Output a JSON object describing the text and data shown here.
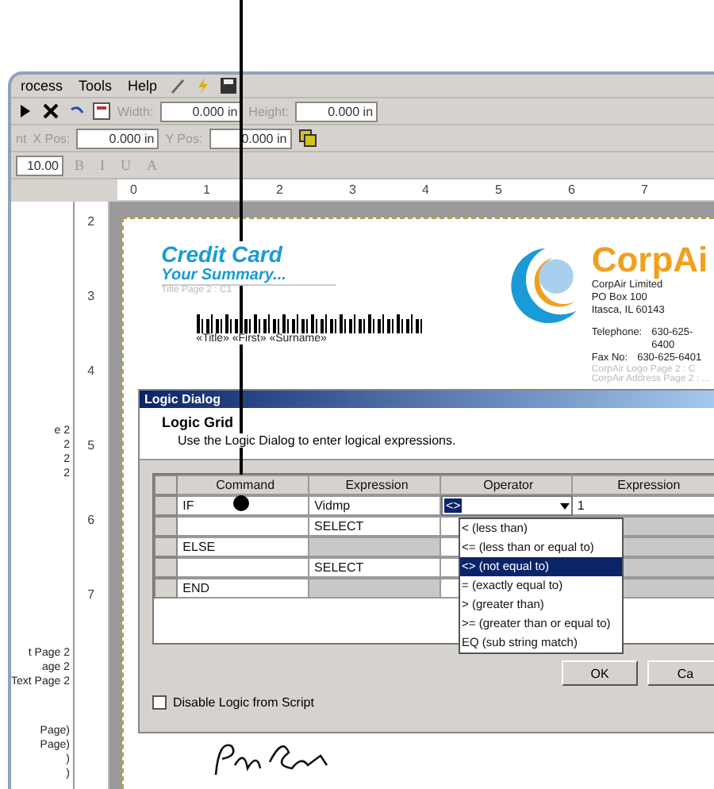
{
  "menu": [
    {
      "label": "rocess"
    },
    {
      "label": "Tools"
    },
    {
      "label": "Help"
    }
  ],
  "size_fields": [
    {
      "label": "Width:",
      "value": "0.000 in"
    },
    {
      "label": "Height:",
      "value": "0.000 in"
    }
  ],
  "position_fields": [
    {
      "label": "X Pos:",
      "value": "0.000 in"
    },
    {
      "label": "Y Pos:",
      "value": "0.000 in"
    }
  ],
  "cut_label": "nt",
  "font_size": "10.00",
  "format_buttons": [
    "B",
    "I",
    "U",
    "A"
  ],
  "ruler": [
    "0",
    "1",
    "2",
    "3",
    "4",
    "5",
    "6",
    "7"
  ],
  "vertical_ruler": [
    "2",
    "3",
    "4",
    "5",
    "6",
    "7"
  ],
  "tree_groups": [
    [
      "e 2",
      "2",
      "2",
      "2"
    ],
    [
      "t Page 2",
      "age 2",
      "Text Page 2"
    ],
    [
      "Page)",
      "Page)",
      ")",
      ")"
    ]
  ],
  "document": {
    "title": "Credit Card",
    "subtitle": "Your Summary...",
    "caption": "Title Page 2 : C1",
    "merge_fields": "«Title» «First» «Surname»",
    "company": "CorpAi",
    "address": [
      "CorpAir Limited",
      "PO Box 100",
      "Itasca, IL 60143"
    ],
    "contacts": [
      {
        "label": "Telephone:",
        "value": "630-625-6400"
      },
      {
        "label": "Fax No:",
        "value": "630-625-6401"
      }
    ],
    "logo_caption": "CorpAir Logo Page 2 : C",
    "address_caption": "CorpAir Address Page 2 : ..."
  },
  "dialog": {
    "title": "Logic Dialog",
    "heading": "Logic Grid",
    "description": "Use the Logic Dialog to enter logical expressions.",
    "columns": [
      "Command",
      "Expression",
      "Operator",
      "Expression"
    ],
    "rows": [
      {
        "command": "IF",
        "expression": "Vidmp",
        "expression_disabled": false,
        "value": "1",
        "value_disabled": false
      },
      {
        "command": "",
        "expression": "SELECT",
        "expression_disabled": false,
        "value": "",
        "value_disabled": true
      },
      {
        "command": "ELSE",
        "expression": "",
        "expression_disabled": true,
        "value": "",
        "value_disabled": true
      },
      {
        "command": "",
        "expression": "SELECT",
        "expression_disabled": false,
        "value": "",
        "value_disabled": true
      },
      {
        "command": "END",
        "expression": "",
        "expression_disabled": true,
        "value": "",
        "value_disabled": true
      }
    ],
    "operator": {
      "value": "<>",
      "options": [
        {
          "label": "< (less than)",
          "selected": false
        },
        {
          "label": "<= (less than or equal to)",
          "selected": false
        },
        {
          "label": "<> (not equal to)",
          "selected": true
        },
        {
          "label": "= (exactly equal to)",
          "selected": false
        },
        {
          "label": "> (greater than)",
          "selected": false
        },
        {
          "label": ">= (greater than or equal to)",
          "selected": false
        },
        {
          "label": "EQ (sub string match)",
          "selected": false
        }
      ]
    },
    "checkbox": {
      "label": "Disable Logic from Script",
      "checked": false
    },
    "buttons": [
      "OK",
      "Ca"
    ]
  }
}
